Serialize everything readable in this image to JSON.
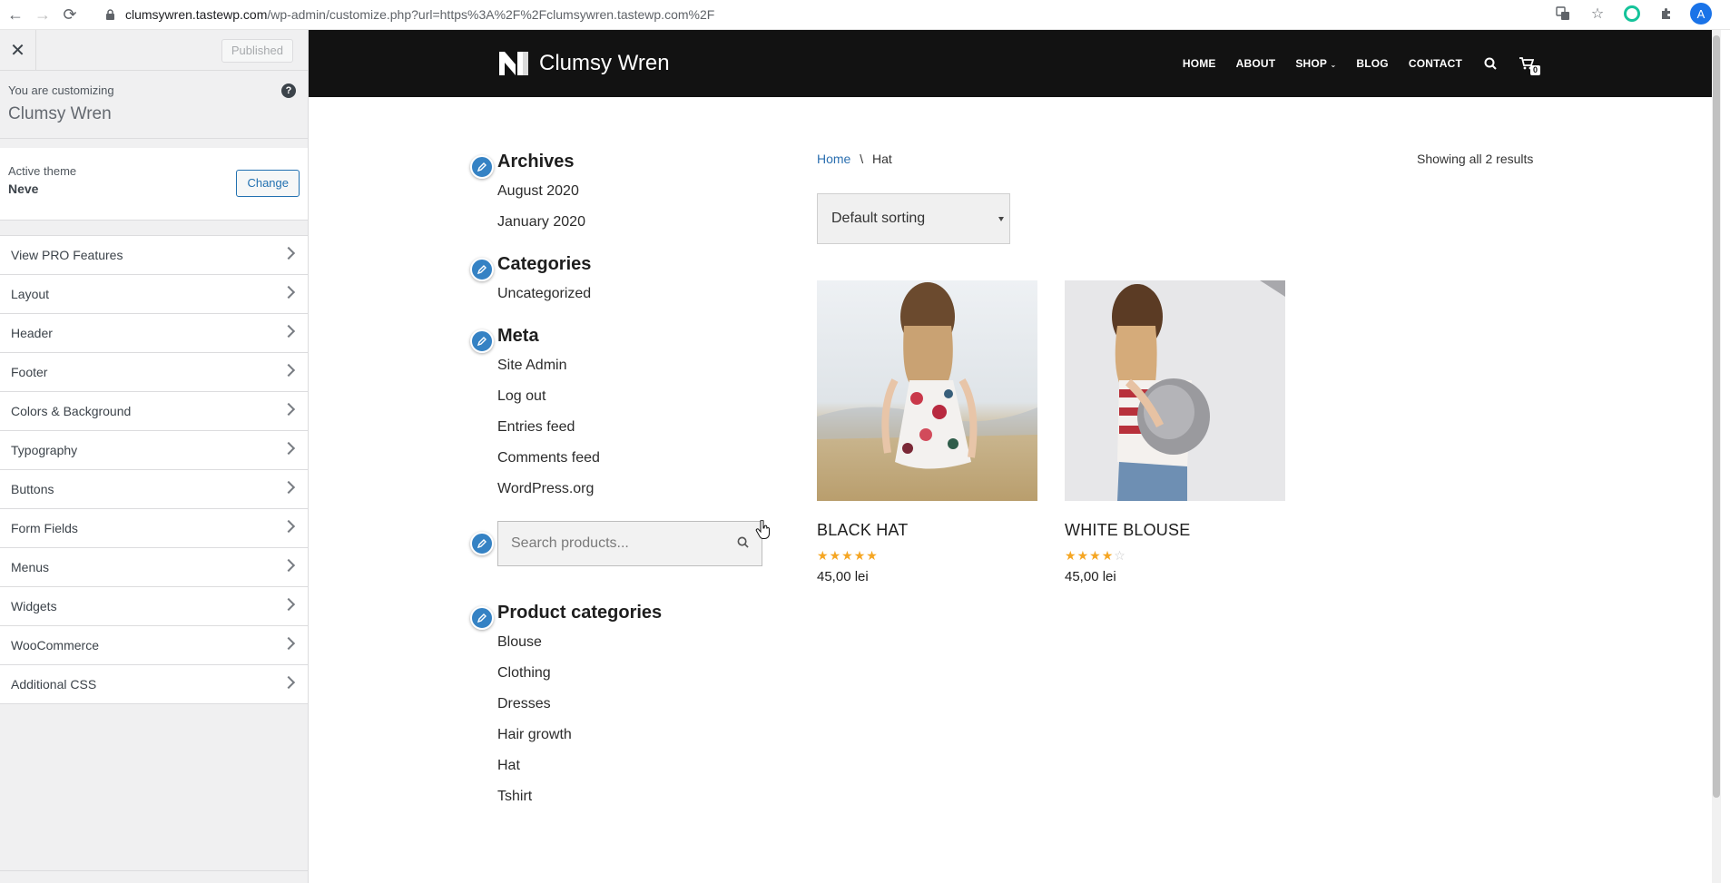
{
  "browser": {
    "url_host": "clumsywren.tastewp.com",
    "url_path": "/wp-admin/customize.php?url=https%3A%2F%2Fclumsywren.tastewp.com%2F",
    "avatar_letter": "A"
  },
  "customizer": {
    "published_label": "Published",
    "customizing_label": "You are customizing",
    "site_title": "Clumsy Wren",
    "active_theme_label": "Active theme",
    "theme_name": "Neve",
    "change_label": "Change",
    "sections": [
      "View PRO Features",
      "Layout",
      "Header",
      "Footer",
      "Colors & Background",
      "Typography",
      "Buttons",
      "Form Fields",
      "Menus",
      "Widgets",
      "WooCommerce",
      "Additional CSS"
    ]
  },
  "site": {
    "logo_text": "Clumsy Wren",
    "nav": [
      "HOME",
      "ABOUT",
      "SHOP",
      "BLOG",
      "CONTACT"
    ],
    "cart_count": "0",
    "widgets": {
      "archives": {
        "title": "Archives",
        "items": [
          "August 2020",
          "January 2020"
        ]
      },
      "categories": {
        "title": "Categories",
        "items": [
          "Uncategorized"
        ]
      },
      "meta": {
        "title": "Meta",
        "items": [
          "Site Admin",
          "Log out",
          "Entries feed",
          "Comments feed",
          "WordPress.org"
        ]
      },
      "search_placeholder": "Search products...",
      "product_categories": {
        "title": "Product categories",
        "items": [
          "Blouse",
          "Clothing",
          "Dresses",
          "Hair growth",
          "Hat",
          "Tshirt"
        ]
      }
    },
    "shop": {
      "breadcrumb_home": "Home",
      "breadcrumb_sep": "\\",
      "breadcrumb_current": "Hat",
      "results_text": "Showing all 2 results",
      "sorting_value": "Default sorting",
      "products": [
        {
          "name": "BLACK HAT",
          "rating": 5,
          "price": "45,00 lei"
        },
        {
          "name": "WHITE BLOUSE",
          "rating": 4,
          "price": "45,00 lei"
        }
      ]
    }
  },
  "colors": {
    "header_bg": "#121212",
    "accent_blue": "#3582c4",
    "star": "#f5a623"
  }
}
